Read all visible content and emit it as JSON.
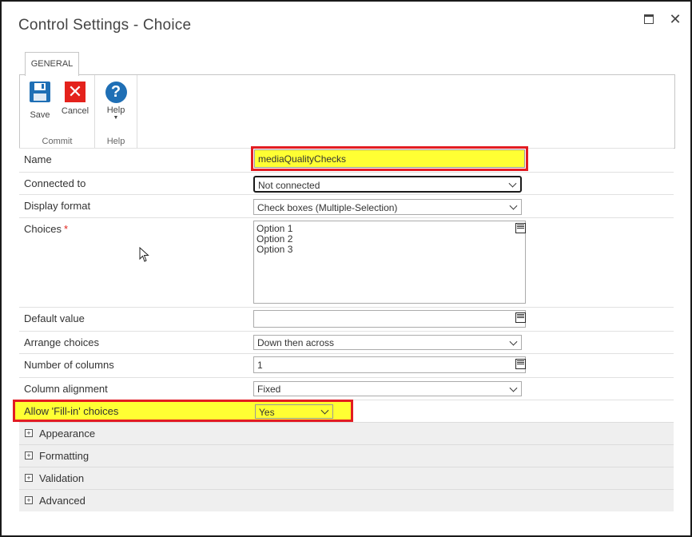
{
  "window": {
    "title": "Control Settings - Choice",
    "maximize_icon": "maximize-icon",
    "close_icon": "close-icon",
    "close_glyph": "✕"
  },
  "ribbon": {
    "tab": "GENERAL",
    "groups": {
      "commit": {
        "label": "Commit",
        "save": "Save",
        "cancel": "Cancel"
      },
      "help": {
        "label": "Help",
        "help": "Help"
      }
    }
  },
  "form": {
    "name": {
      "label": "Name",
      "value": "mediaQualityChecks"
    },
    "connected_to": {
      "label": "Connected to",
      "value": "Not connected"
    },
    "display_format": {
      "label": "Display format",
      "value": "Check boxes (Multiple-Selection)"
    },
    "choices": {
      "label": "Choices",
      "required_mark": "*",
      "value": "Option 1\nOption 2\nOption 3"
    },
    "default_value": {
      "label": "Default value",
      "value": ""
    },
    "arrange_choices": {
      "label": "Arrange choices",
      "value": "Down then across"
    },
    "number_of_columns": {
      "label": "Number of columns",
      "value": "1"
    },
    "column_alignment": {
      "label": "Column alignment",
      "value": "Fixed"
    },
    "allow_fill_in": {
      "label": "Allow 'Fill-in' choices",
      "value": "Yes"
    }
  },
  "sections": [
    {
      "label": "Appearance"
    },
    {
      "label": "Formatting"
    },
    {
      "label": "Validation"
    },
    {
      "label": "Advanced"
    }
  ],
  "colors": {
    "highlight_red": "#e21c22",
    "highlight_yellow": "#ffff33",
    "save_blue": "#1f6fb5",
    "cancel_red": "#e4221c"
  }
}
